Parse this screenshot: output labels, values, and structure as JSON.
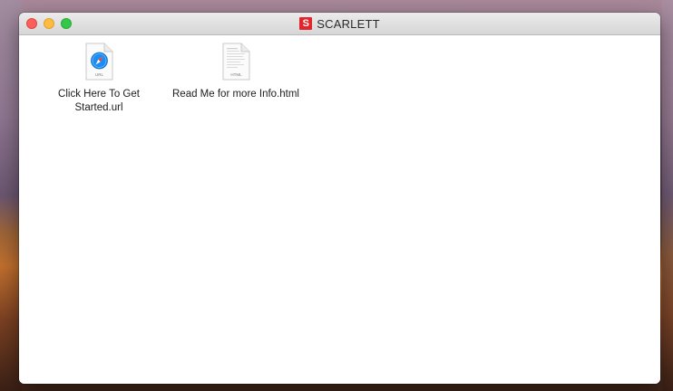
{
  "window": {
    "title": "SCARLETT",
    "title_icon_letter": "S",
    "title_icon_color": "#e3252b"
  },
  "files": [
    {
      "name": "Click Here To Get Started.url",
      "icon": "safari-url-file-icon",
      "badge": "URL"
    },
    {
      "name": "Read Me for more Info.html",
      "icon": "html-document-icon",
      "badge": "HTML"
    }
  ]
}
